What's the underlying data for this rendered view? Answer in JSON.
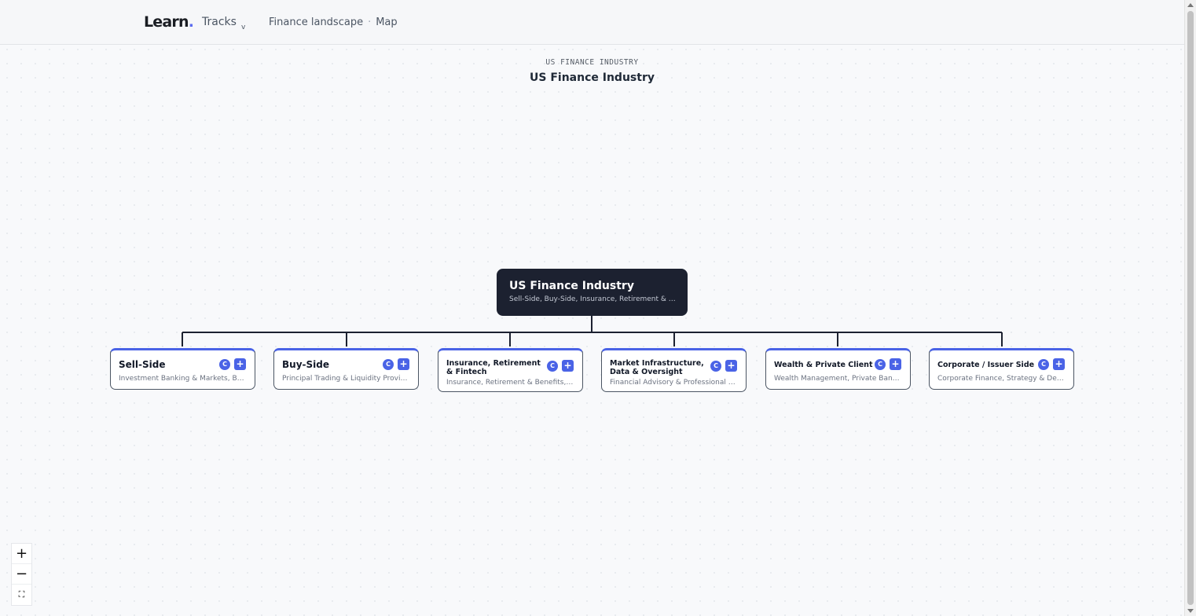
{
  "topbar": {
    "logo": "Learn",
    "logo_dot": ".",
    "tracks_label": "Tracks",
    "tracks_chevron": "v",
    "breadcrumb": [
      "Finance landscape",
      "Map"
    ],
    "breadcrumb_separator": "·"
  },
  "map": {
    "eyebrow": "US FINANCE INDUSTRY",
    "title": "US Finance Industry",
    "root": {
      "title": "US Finance Industry",
      "subtitle": "Sell-Side, Buy-Side, Insurance, Retirement & Fintech, Market Infrastructure, Data & Oversight, Wealth & Private Client, Corporate / Issuer Side"
    },
    "nodes": [
      {
        "title": "Sell-Side",
        "subtitle": "Investment Banking & Markets, Banking & Lending",
        "c_label": "C",
        "plus_label": "+"
      },
      {
        "title": "Buy-Side",
        "subtitle": "Principal Trading & Liquidity Providers, Asset Management",
        "c_label": "C",
        "plus_label": "+"
      },
      {
        "title": "Insurance, Retirement & Fintech",
        "subtitle": "Insurance, Retirement & Benefits, Fintech & Payments",
        "c_label": "C",
        "plus_label": "+"
      },
      {
        "title": "Market Infrastructure, Data & Oversight",
        "subtitle": "Financial Advisory & Professional Services, Market Infrastructure",
        "c_label": "C",
        "plus_label": "+"
      },
      {
        "title": "Wealth & Private Client",
        "subtitle": "Wealth Management, Private Banking & Family Offices",
        "c_label": "C",
        "plus_label": "+"
      },
      {
        "title": "Corporate / Issuer Side",
        "subtitle": "Corporate Finance, Strategy & Deals, Treasury",
        "c_label": "C",
        "plus_label": "+"
      }
    ]
  },
  "zoom_controls": {
    "zoom_in": "+",
    "zoom_out": "−",
    "fit": "⛶"
  },
  "colors": {
    "accent": "#4a63e6",
    "root_bg": "#1c2130",
    "connector": "#1c2130"
  }
}
